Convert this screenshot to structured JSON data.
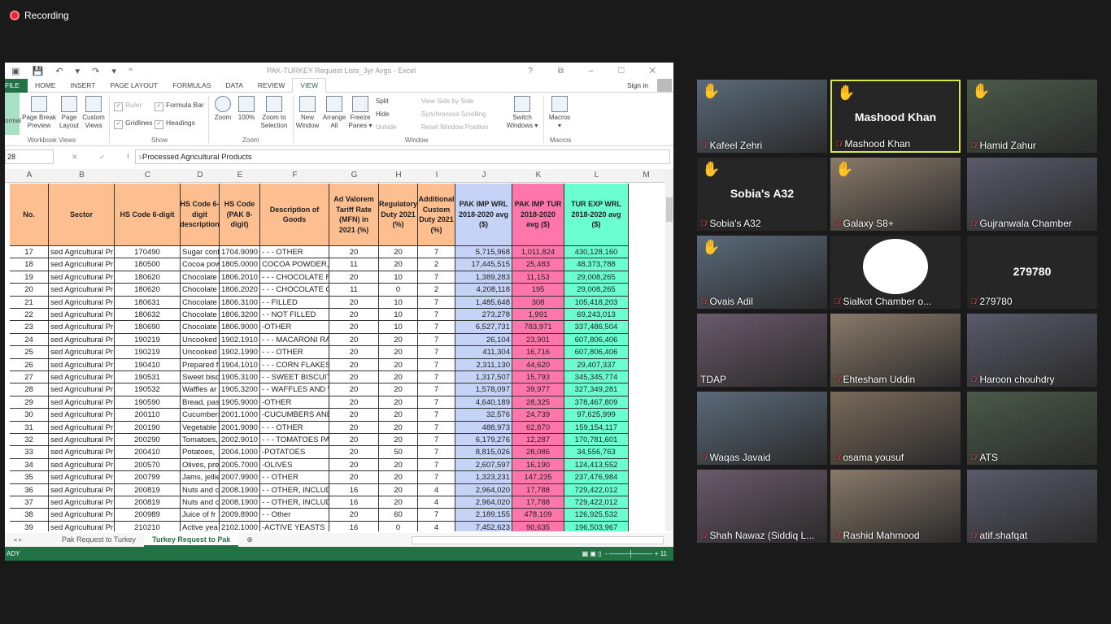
{
  "recording": "Recording",
  "excel": {
    "quick_access": "▣ 💾 ↶ ▾ ↷ ▾ ⁼",
    "title": "PAK-TURKEY Request Lists_3yr Avgs - Excel",
    "window_controls": "? ⧉ – ☐ ✕",
    "tabs": [
      "FILE",
      "HOME",
      "INSERT",
      "PAGE LAYOUT",
      "FORMULAS",
      "DATA",
      "REVIEW",
      "VIEW"
    ],
    "active_tab": "VIEW",
    "sign_in": "Sign in",
    "ribbon": {
      "normal": "ormal",
      "page_break": "Page Break Preview",
      "page_layout": "Page Layout",
      "custom_views": "Custom Views",
      "group_workbook": "Workbook Views",
      "ruler": "Ruler",
      "formula_bar": "Formula Bar",
      "gridlines": "Gridlines",
      "headings": "Headings",
      "group_show": "Show",
      "zoom": "Zoom",
      "zoom100": "100%",
      "zoom_sel": "Zoom to Selection",
      "group_zoom": "Zoom",
      "new_window": "New Window",
      "arrange_all": "Arrange All",
      "freeze": "Freeze Panes ▾",
      "split": "Split",
      "hide": "Hide",
      "unhide": "Unhide",
      "side_by_side": "View Side by Side",
      "sync_scroll": "Synchronous Scrolling",
      "reset_pos": "Reset Window Position",
      "switch": "Switch Windows ▾",
      "group_window": "Window",
      "macros": "Macros ▾",
      "group_macros": "Macros"
    },
    "name_box": "28",
    "fx": "✕ ✓ fx",
    "formula": "Processed Agricultural Products",
    "columns": [
      "A",
      "B",
      "C",
      "D",
      "E",
      "F",
      "G",
      "H",
      "I",
      "J",
      "K",
      "L",
      "M"
    ],
    "headers": [
      "No.",
      "Sector",
      "HS Code 6-digit",
      "HS Code 6-digit description",
      "HS Code (PAK 8-digit)",
      "Description of Goods",
      "Ad Valorem Tariff Rate (MFN) in 2021 (%)",
      "Regulatory Duty 2021 (%)",
      "Additional Custom Duty 2021 (%)",
      "PAK IMP WRL 2018-2020 avg ($)",
      "PAK IMP TUR 2018-2020 avg ($)",
      "TUR EXP WRL 2018-2020 avg ($)"
    ],
    "header_colors": {
      "orange": "#fdbf90",
      "blue": "#c5d3f7",
      "pink": "#ff77aa",
      "green": "#6bffd0"
    },
    "rows": [
      [
        "17",
        "sed Agricultural Pr",
        "170490",
        "Sugar conf",
        "1704.9090",
        "- - - OTHER",
        "20",
        "20",
        "7",
        "5,715,968",
        "1,011,824",
        "430,128,160"
      ],
      [
        "18",
        "sed Agricultural Pr",
        "180500",
        "Cocoa pow",
        "1805.0000",
        "COCOA POWDER,",
        "11",
        "20",
        "2",
        "17,445,515",
        "25,483",
        "48,373,788"
      ],
      [
        "19",
        "sed Agricultural Pr",
        "180620",
        "Chocolate",
        "1806.2010",
        "- - - CHOCOLATE F",
        "20",
        "10",
        "7",
        "1,389,283",
        "11,153",
        "29,008,265"
      ],
      [
        "20",
        "sed Agricultural Pr",
        "180620",
        "Chocolate",
        "1806.2020",
        "- - - CHOCOLATE C",
        "11",
        "0",
        "2",
        "4,208,118",
        "195",
        "29,008,265"
      ],
      [
        "21",
        "sed Agricultural Pr",
        "180631",
        "Chocolate",
        "1806.3100",
        "- - FILLED",
        "20",
        "10",
        "7",
        "1,485,648",
        "308",
        "105,418,203"
      ],
      [
        "22",
        "sed Agricultural Pr",
        "180632",
        "Chocolate",
        "1806.3200",
        "- - NOT FILLED",
        "20",
        "10",
        "7",
        "273,278",
        "1,991",
        "69,243,013"
      ],
      [
        "23",
        "sed Agricultural Pr",
        "180690",
        "Chocolate",
        "1806.9000",
        "-OTHER",
        "20",
        "10",
        "7",
        "6,527,731",
        "783,971",
        "337,486,504"
      ],
      [
        "24",
        "sed Agricultural Pr",
        "190219",
        "Uncooked",
        "1902.1910",
        "- - - MACARONI RA",
        "20",
        "20",
        "7",
        "26,104",
        "23,901",
        "607,806,406"
      ],
      [
        "25",
        "sed Agricultural Pr",
        "190219",
        "Uncooked",
        "1902.1990",
        "- - - OTHER",
        "20",
        "20",
        "7",
        "411,304",
        "16,716",
        "607,806,406"
      ],
      [
        "26",
        "sed Agricultural Pr",
        "190410",
        "Prepared f",
        "1904.1010",
        "- - - CORN FLAKES",
        "20",
        "20",
        "7",
        "2,311,130",
        "44,620",
        "29,407,337"
      ],
      [
        "27",
        "sed Agricultural Pr",
        "190531",
        "Sweet bisc",
        "1905.3100",
        "- - SWEET BISCUIT",
        "20",
        "20",
        "7",
        "1,317,507",
        "15,793",
        "345,345,774"
      ],
      [
        "28",
        "sed Agricultural Pr",
        "190532",
        "Waffles ar",
        "1905.3200",
        "- - WAFFLES AND W",
        "20",
        "20",
        "7",
        "1,578,097",
        "39,977",
        "327,349,281"
      ],
      [
        "29",
        "sed Agricultural Pr",
        "190590",
        "Bread, pas",
        "1905.9000",
        "-OTHER",
        "20",
        "20",
        "7",
        "4,640,189",
        "28,325",
        "378,467,809"
      ],
      [
        "30",
        "sed Agricultural Pr",
        "200110",
        "Cucumbers",
        "2001.1000",
        "-CUCUMBERS AND",
        "20",
        "20",
        "7",
        "32,576",
        "24,739",
        "97,625,999"
      ],
      [
        "31",
        "sed Agricultural Pr",
        "200190",
        "Vegetable",
        "2001.9090",
        "- - - OTHER",
        "20",
        "20",
        "7",
        "488,973",
        "62,870",
        "159,154,117"
      ],
      [
        "32",
        "sed Agricultural Pr",
        "200290",
        "Tomatoes,",
        "2002.9010",
        "- - - TOMATOES PA",
        "20",
        "20",
        "7",
        "6,179,276",
        "12,287",
        "170,781,601"
      ],
      [
        "33",
        "sed Agricultural Pr",
        "200410",
        "Potatoes,",
        "2004.1000",
        "-POTATOES",
        "20",
        "50",
        "7",
        "8,815,026",
        "28,086",
        "34,556,763"
      ],
      [
        "34",
        "sed Agricultural Pr",
        "200570",
        "Olives, pre",
        "2005.7000",
        "-OLIVES",
        "20",
        "20",
        "7",
        "2,607,597",
        "16,190",
        "124,413,552"
      ],
      [
        "35",
        "sed Agricultural Pr",
        "200799",
        "Jams, jellie",
        "2007.9900",
        "- - OTHER",
        "20",
        "20",
        "7",
        "1,323,231",
        "147,235",
        "237,476,984"
      ],
      [
        "36",
        "sed Agricultural Pr",
        "200819",
        "Nuts and c",
        "2008.1900",
        "- - OTHER, INCLUD",
        "16",
        "20",
        "4",
        "2,964,020",
        "17,788",
        "729,422,012"
      ],
      [
        "37",
        "sed Agricultural Pr",
        "200819",
        "Nuts and c",
        "2008.1900",
        "- - OTHER, INCLUD",
        "16",
        "20",
        "4",
        "2,964,020",
        "17,788",
        "729,422,012"
      ],
      [
        "38",
        "sed Agricultural Pr",
        "200989",
        "Juice of fr",
        "2009.8900",
        "- - Other",
        "20",
        "60",
        "7",
        "2,189,155",
        "478,109",
        "126,925,532"
      ],
      [
        "39",
        "sed Agricultural Pr",
        "210210",
        "Active yea",
        "2102.1000",
        "-ACTIVE YEASTS",
        "16",
        "0",
        "4",
        "7,452,623",
        "90,635",
        "196,503,967"
      ]
    ],
    "sheet_tabs": [
      "Pak Request to Turkey",
      "Turkey Request to Pak"
    ],
    "active_sheet": "Turkey Request to Pak",
    "status": "ADY",
    "zoom": "11"
  },
  "participants": [
    {
      "name": "Kafeel Zehri",
      "hand": true,
      "video": true
    },
    {
      "name": "Mashood Khan",
      "hand": true,
      "video": false,
      "big": "Mashood Khan",
      "active": true
    },
    {
      "name": "Hamid Zahur",
      "hand": true,
      "video": true
    },
    {
      "name": "Sobia's A32",
      "hand": true,
      "video": false,
      "big": "Sobia's A32"
    },
    {
      "name": "Galaxy S8+",
      "hand": true,
      "video": true
    },
    {
      "name": "Gujranwala Chamber",
      "hand": false,
      "video": true
    },
    {
      "name": "Ovais Adil",
      "hand": true,
      "video": true
    },
    {
      "name": "Sialkot Chamber o...",
      "hand": false,
      "video": true,
      "logo": "SCCI"
    },
    {
      "name": "279780",
      "hand": false,
      "video": false,
      "big": "279780"
    },
    {
      "name": "TDAP",
      "hand": false,
      "video": true,
      "nomic": true
    },
    {
      "name": "Ehtesham Uddin",
      "hand": false,
      "video": true
    },
    {
      "name": "Haroon chouhdry",
      "hand": false,
      "video": true
    },
    {
      "name": "Waqas Javaid",
      "hand": false,
      "video": true
    },
    {
      "name": "osama yousuf",
      "hand": false,
      "video": true
    },
    {
      "name": "ATS",
      "hand": false,
      "video": true
    },
    {
      "name": "Shah Nawaz (Siddiq L...",
      "hand": false,
      "video": true
    },
    {
      "name": "Rashid Mahmood",
      "hand": false,
      "video": true
    },
    {
      "name": "atif.shafqat",
      "hand": false,
      "video": true
    }
  ]
}
